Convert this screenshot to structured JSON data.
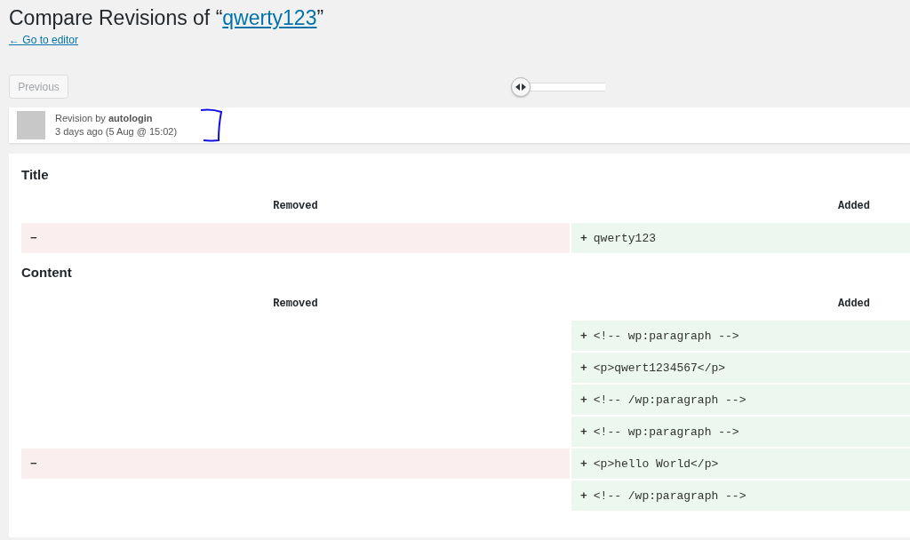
{
  "page": {
    "title_text": "Compare Revisions of “",
    "title_link": "qwerty123",
    "title_end": "”",
    "back_link": "← Go to editor"
  },
  "navigation": {
    "previous_button": {
      "label": "Previous",
      "disabled": true
    },
    "slider": {
      "level": 0
    }
  },
  "revision": {
    "byline": "Revision by **autologin**",
    "time": "3 days ago (5 Aug @ 15:02)"
  },
  "sections": [
    {
      "heading": "Title",
      "columns": [
        "Removed",
        "Added"
      ],
      "rows": [
        {
          "removed": {
            "kind": "removed",
            "sign": "−"
          },
          "added": {
            "kind": "added",
            "sign": "+",
            "text": "qwerty123"
          }
        }
      ]
    },
    {
      "heading": "Content",
      "columns": [
        "Removed",
        "Added"
      ],
      "rows": [
        {
          "removed": {
            "kind": "empty"
          },
          "added": {
            "kind": "added",
            "sign": "+",
            "text": "<!-- wp:paragraph -->"
          }
        },
        {
          "removed": {
            "kind": "empty"
          },
          "added": {
            "kind": "added",
            "sign": "+",
            "text": "<p>qwert1234567</p>"
          }
        },
        {
          "removed": {
            "kind": "empty"
          },
          "added": {
            "kind": "added",
            "sign": "+",
            "text": "<!-- /wp:paragraph -->"
          }
        },
        {
          "removed": {
            "kind": "empty"
          },
          "added": {
            "kind": "added",
            "sign": "+",
            "text": "<!-- wp:paragraph -->"
          }
        },
        {
          "removed": {
            "kind": "removed",
            "sign": "−"
          },
          "added": {
            "kind": "added",
            "sign": "+",
            "text": "<p>hello World</p>"
          }
        },
        {
          "removed": {
            "kind": "empty"
          },
          "added": {
            "kind": "added",
            "sign": "+",
            "text": "<!-- /wp:paragraph -->"
          }
        }
      ]
    }
  ]
}
